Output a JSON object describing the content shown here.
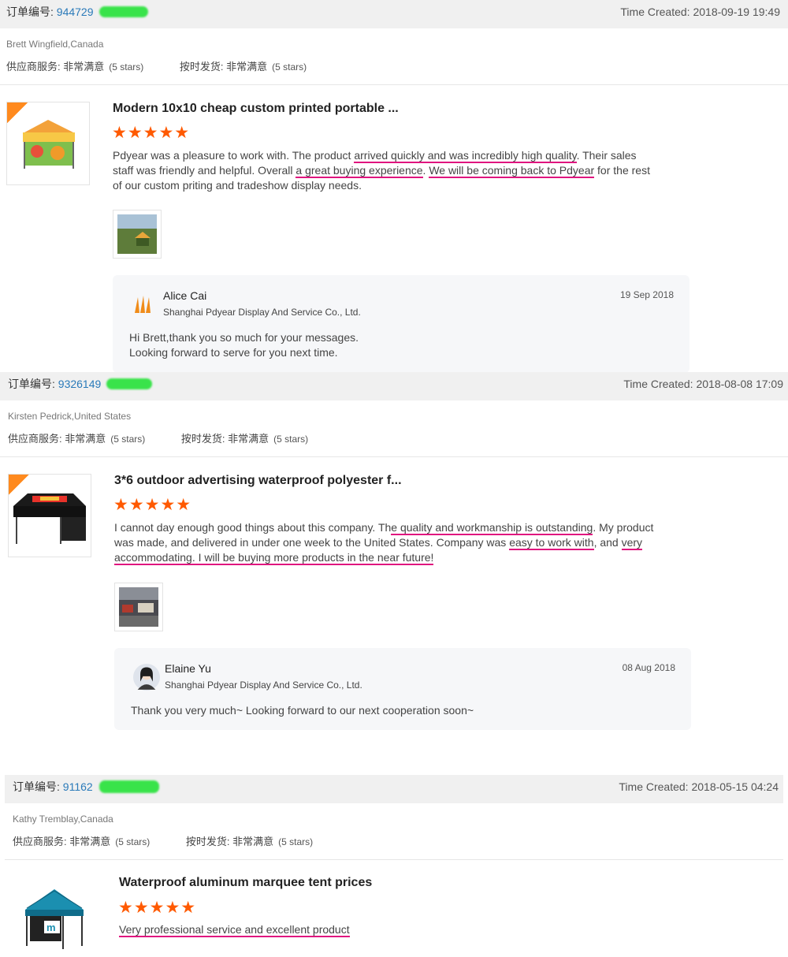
{
  "orders": [
    {
      "order_label": "订单编号:",
      "order_number": "944729",
      "time_created": "Time Created: 2018-09-19 19:49",
      "buyer": "Brett Wingfield,Canada",
      "rating_service_label": "供应商服务: 非常满意",
      "rating_service_stars": "(5 stars)",
      "rating_shipping_label": "按时发货: 非常满意",
      "rating_shipping_stars": "(5 stars)",
      "product_title": "Modern 10x10 cheap custom printed portable ...",
      "stars": "★★★★★",
      "review_parts": [
        "Pdyear was a pleasure to work with. The product ",
        "arrived quickly and was incredibly high quality",
        ". Their sales staff was friendly and helpful. Overall ",
        "a great buying experience",
        ". ",
        "We will be coming back to Pdyear",
        " for the rest of our custom priting and tradeshow display needs."
      ],
      "reply": {
        "name": "Alice Cai",
        "company": "Shanghai Pdyear Display And Service Co., Ltd.",
        "date": "19 Sep 2018",
        "message_line1": "Hi Brett,thank you so much for your messages.",
        "message_line2": "Looking forward to serve for you next time."
      }
    },
    {
      "order_label": "订单编号:",
      "order_number": "9326149",
      "time_created": "Time Created: 2018-08-08 17:09",
      "buyer": "Kirsten Pedrick,United States",
      "rating_service_label": "供应商服务: 非常满意",
      "rating_service_stars": "(5 stars)",
      "rating_shipping_label": "按时发货: 非常满意",
      "rating_shipping_stars": "(5 stars)",
      "product_title": "3*6 outdoor advertising waterproof polyester f...",
      "stars": "★★★★★",
      "review_parts": [
        "I cannot day enough good things about this company. Th",
        "e quality and workmanship is outstanding",
        ". My product was made, and delivered in under one week to the United States. Company was ",
        "easy to work with",
        ", and ",
        "very accommodating. I will be buying more products in the near future!",
        ""
      ],
      "reply": {
        "name": "Elaine Yu",
        "company": "Shanghai Pdyear Display And Service Co., Ltd.",
        "date": "08 Aug 2018",
        "message_line1": "Thank you very much~ Looking forward to our next cooperation soon~",
        "message_line2": ""
      }
    },
    {
      "order_label": "订单编号:",
      "order_number": "91162",
      "time_created": "Time Created: 2018-05-15 04:24",
      "buyer": "Kathy Tremblay,Canada",
      "rating_service_label": "供应商服务: 非常满意",
      "rating_service_stars": "(5 stars)",
      "rating_shipping_label": "按时发货: 非常满意",
      "rating_shipping_stars": "(5 stars)",
      "product_title": "Waterproof aluminum marquee tent prices",
      "stars": "★★★★★",
      "review_parts": [
        "",
        "Very professional service and excellent product",
        "",
        "",
        "",
        "",
        ""
      ]
    }
  ],
  "colors": {
    "accent_star": "#ff5a00",
    "link_blue": "#2a7ab9",
    "underline_pink": "#e0157f",
    "redaction_green": "#39e34a"
  }
}
